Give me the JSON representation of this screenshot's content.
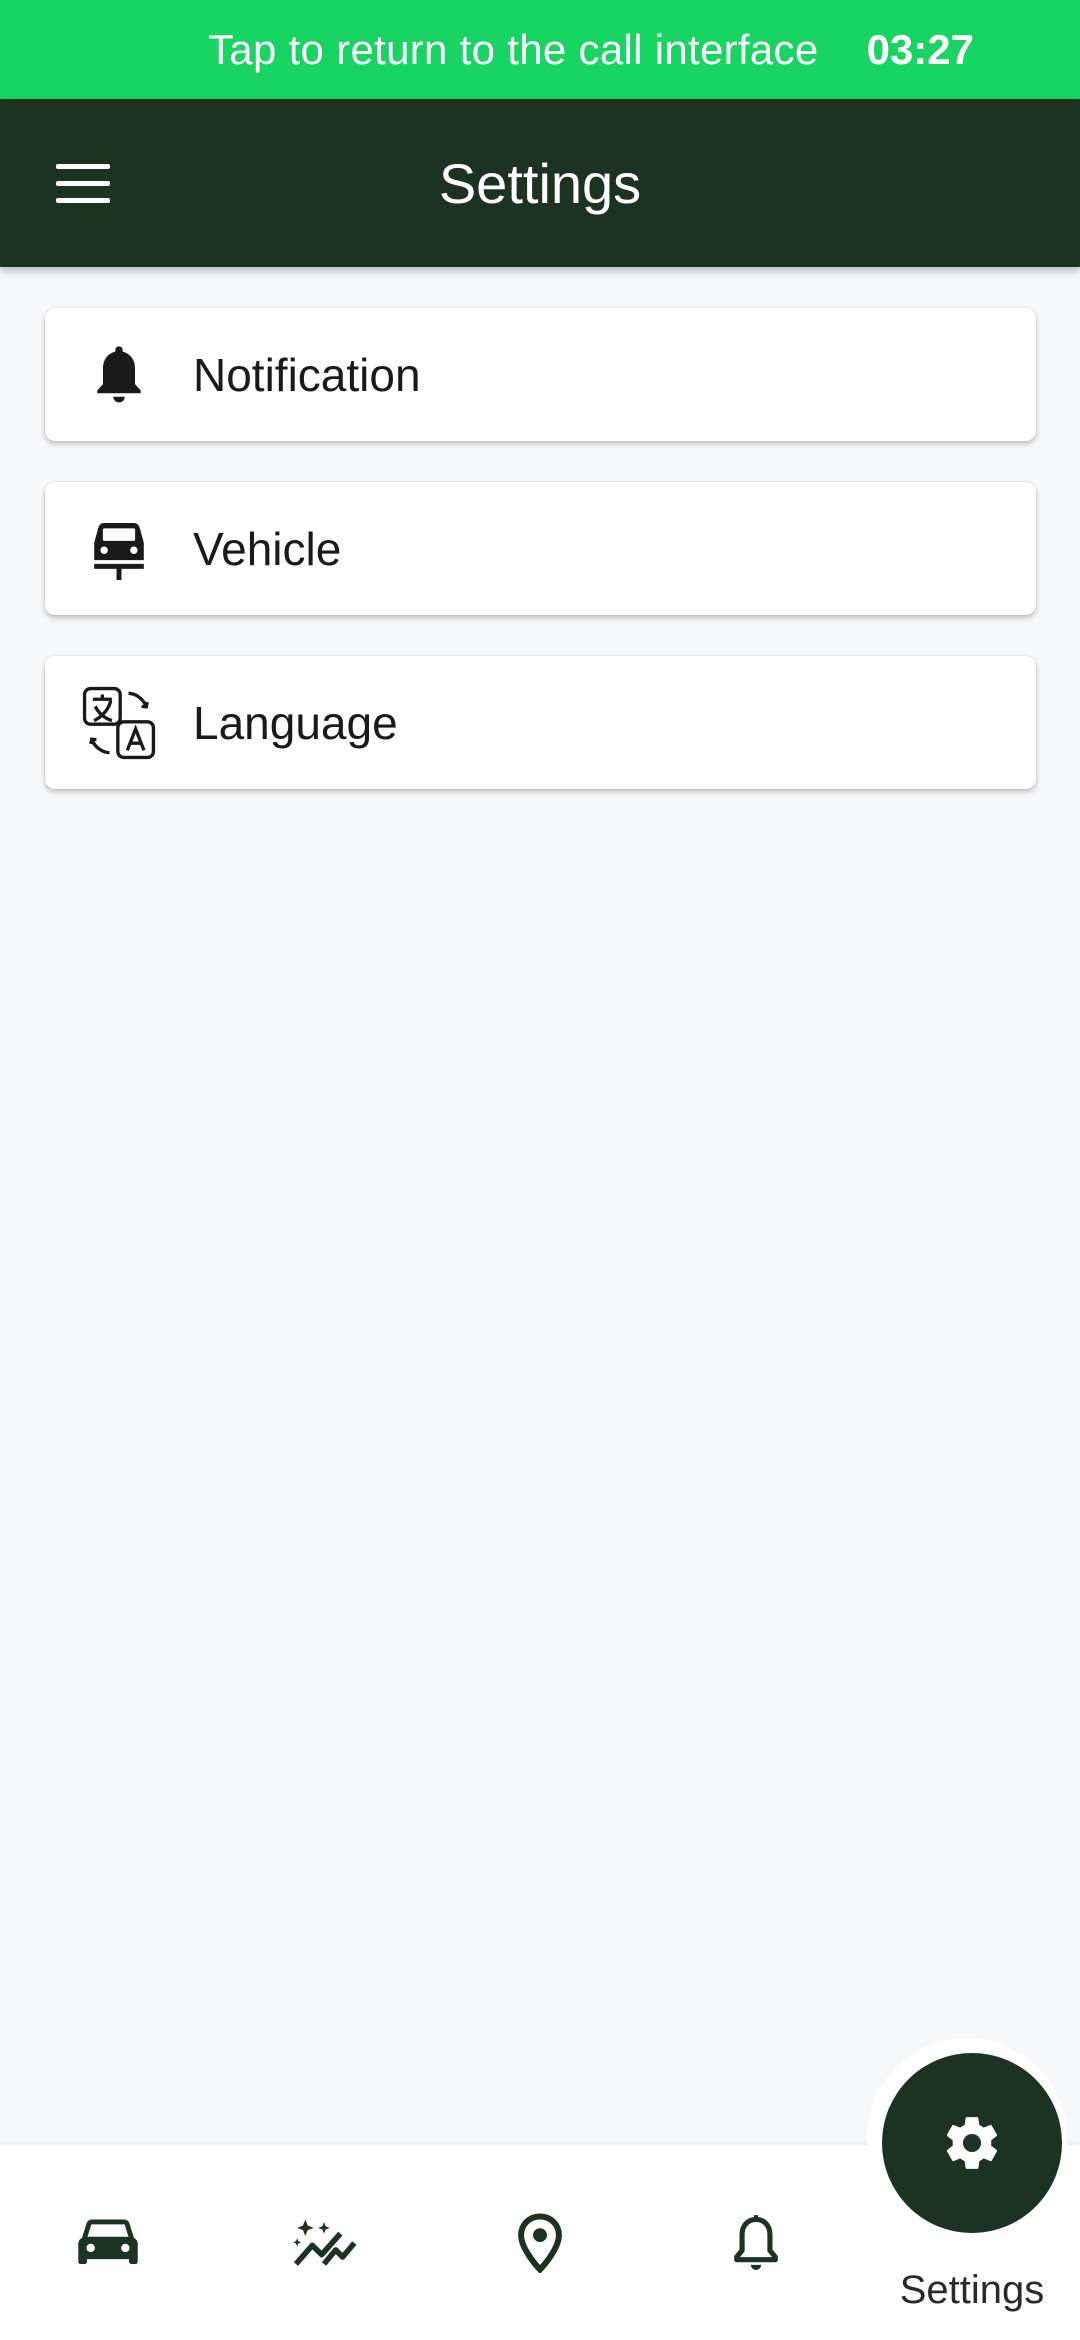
{
  "call_bar": {
    "text": "Tap to return to the call interface",
    "time": "03:27",
    "color": "#18d462"
  },
  "header": {
    "title": "Settings",
    "menu_icon": "hamburger-menu-icon",
    "color": "#1c3322"
  },
  "settings_items": [
    {
      "label": "Notification",
      "icon": "bell-icon"
    },
    {
      "label": "Vehicle",
      "icon": "vehicle-icon"
    },
    {
      "label": "Language",
      "icon": "translate-icon"
    }
  ],
  "bottom_nav": {
    "items": [
      {
        "icon": "car-icon"
      },
      {
        "icon": "analytics-sparkle-icon"
      },
      {
        "icon": "location-pin-icon"
      },
      {
        "icon": "bell-icon"
      }
    ],
    "active": {
      "icon": "gear-icon",
      "label": "Settings"
    }
  }
}
